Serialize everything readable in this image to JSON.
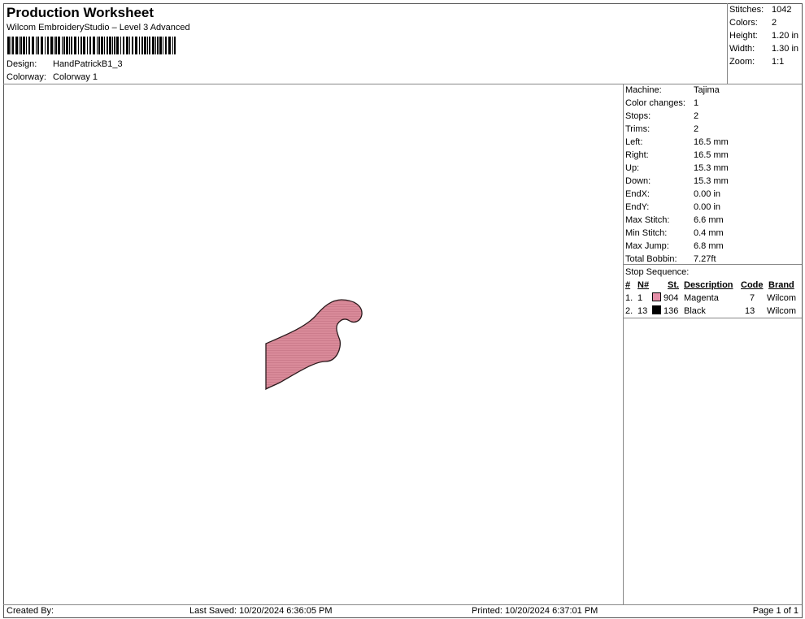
{
  "header": {
    "title": "Production Worksheet",
    "software": "Wilcom EmbroideryStudio – Level 3 Advanced",
    "design_label": "Design:",
    "design_value": "HandPatrickB1_3",
    "colorway_label": "Colorway:",
    "colorway_value": "Colorway 1"
  },
  "summary": [
    {
      "label": "Stitches:",
      "value": "1042"
    },
    {
      "label": "Colors:",
      "value": "2"
    },
    {
      "label": "Height:",
      "value": "1.20 in"
    },
    {
      "label": "Width:",
      "value": "1.30 in"
    },
    {
      "label": "Zoom:",
      "value": "1:1"
    }
  ],
  "details": [
    {
      "label": "Machine:",
      "value": "Tajima"
    },
    {
      "label": "Color changes:",
      "value": "1"
    },
    {
      "label": "Stops:",
      "value": "2"
    },
    {
      "label": "Trims:",
      "value": "2"
    },
    {
      "label": "Left:",
      "value": "16.5 mm"
    },
    {
      "label": "Right:",
      "value": "16.5 mm"
    },
    {
      "label": "Up:",
      "value": "15.3 mm"
    },
    {
      "label": "Down:",
      "value": "15.3 mm"
    },
    {
      "label": "EndX:",
      "value": "0.00 in"
    },
    {
      "label": "EndY:",
      "value": "0.00 in"
    },
    {
      "label": "Max Stitch:",
      "value": "6.6 mm"
    },
    {
      "label": "Min Stitch:",
      "value": "0.4 mm"
    },
    {
      "label": "Max Jump:",
      "value": "6.8 mm"
    },
    {
      "label": "Total Bobbin:",
      "value": "7.27ft"
    }
  ],
  "stop_sequence": {
    "title": "Stop Sequence:",
    "headers": {
      "num": "#",
      "n": "N#",
      "st": "St.",
      "description": "Description",
      "code": "Code",
      "brand": "Brand"
    },
    "rows": [
      {
        "num": "1.",
        "n": "1",
        "swatch": "#e48fa8",
        "st": "904",
        "description": "Magenta",
        "code": "7",
        "brand": "Wilcom"
      },
      {
        "num": "2.",
        "n": "13",
        "swatch": "#000000",
        "st": "136",
        "description": "Black",
        "code": "13",
        "brand": "Wilcom"
      }
    ]
  },
  "footer": {
    "created_by": "Created By:",
    "last_saved": "Last Saved: 10/20/2024 6:36:05 PM",
    "printed": "Printed: 10/20/2024 6:37:01 PM",
    "page": "Page 1 of 1"
  },
  "design_fill_color": "#d98a99"
}
